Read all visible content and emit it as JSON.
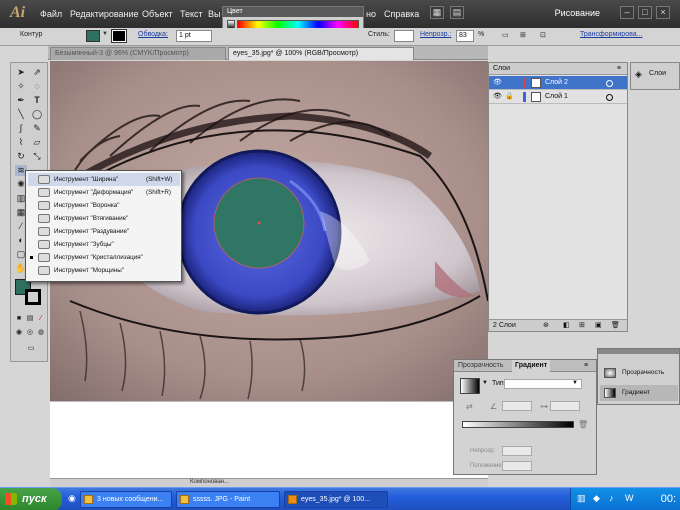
{
  "app": {
    "logo": "Ai",
    "menus": [
      "Файл",
      "Редактирование",
      "Объект",
      "Текст",
      "Вы",
      "но",
      "Справка"
    ],
    "workspace": "Рисование"
  },
  "color_panel": {
    "title": "Цвет"
  },
  "control_bar": {
    "object_type": "Контур",
    "fill_color": "#2e7060",
    "stroke_label": "Обводка:",
    "stroke_weight": "1 pt",
    "style_label": "Стиль:",
    "opacity_label": "Непрозр.:",
    "opacity_value": "83",
    "opacity_unit": "%",
    "transform_link": "Трансформирова..."
  },
  "tabs": [
    {
      "label": "Безымянный-3 @ 96% (CMYK/Просмотр)",
      "active": false
    },
    {
      "label": "eyes_35.jpg* @ 100% (RGB/Просмотр)",
      "active": true
    }
  ],
  "tool_flyout": {
    "items": [
      {
        "name": "Инструмент \"Ширина\"",
        "shortcut": "(Shift+W)",
        "selected": true,
        "current": false
      },
      {
        "name": "Инструмент \"Деформация\"",
        "shortcut": "(Shift+R)",
        "selected": false,
        "current": false
      },
      {
        "name": "Инструмент \"Воронка\"",
        "shortcut": "",
        "selected": false,
        "current": false
      },
      {
        "name": "Инструмент \"Втягивание\"",
        "shortcut": "",
        "selected": false,
        "current": false
      },
      {
        "name": "Инструмент \"Раздувание\"",
        "shortcut": "",
        "selected": false,
        "current": false
      },
      {
        "name": "Инструмент \"Зубцы\"",
        "shortcut": "",
        "selected": false,
        "current": false
      },
      {
        "name": "Инструмент \"Кристаллизация\"",
        "shortcut": "",
        "selected": false,
        "current": true
      },
      {
        "name": "Инструмент \"Морщины\"",
        "shortcut": "",
        "selected": false,
        "current": false
      }
    ]
  },
  "layers_panel": {
    "tab": "Слои",
    "layers": [
      {
        "name": "Слой 2",
        "selected": true
      },
      {
        "name": "Слой 1",
        "selected": false
      }
    ],
    "footer": "2 Слои"
  },
  "right_dock": {
    "label": "Слои"
  },
  "gradient_panel": {
    "tab_transparency": "Прозрачность",
    "tab_gradient": "Градиент",
    "type_label": "Тип:",
    "opacity_label": "Непрозр:",
    "location_label": "Положение:"
  },
  "mini_panel": {
    "items": [
      "Прозрачность",
      "Градиент"
    ]
  },
  "taskbar": {
    "start": "пуск",
    "tasks": [
      {
        "label": "3 новых сообщени...",
        "active": false
      },
      {
        "label": "sssss. JPG - Paint",
        "active": false
      },
      {
        "label": "eyes_35.jpg* @ 100...",
        "active": true
      }
    ],
    "clock": "00:"
  },
  "hscroll": {
    "label": "Компонован..."
  },
  "colors": {
    "iris_outer": "#3b49c4",
    "iris_fill": "#2f7664",
    "selected_layer": "#3f74c8"
  }
}
